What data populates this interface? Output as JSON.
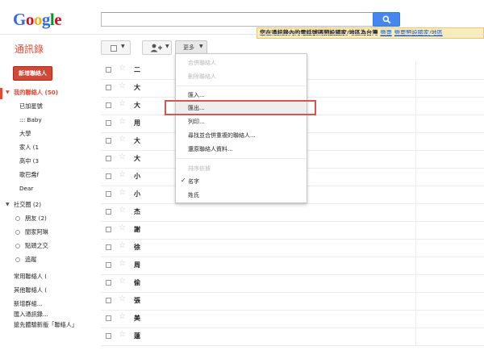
{
  "header": {
    "logo_letters": [
      {
        "ch": "G",
        "color": "#3369e8"
      },
      {
        "ch": "o",
        "color": "#d50f25"
      },
      {
        "ch": "o",
        "color": "#eeb211"
      },
      {
        "ch": "g",
        "color": "#3369e8"
      },
      {
        "ch": "l",
        "color": "#009925"
      },
      {
        "ch": "e",
        "color": "#d50f25"
      }
    ],
    "search_icon": "search-icon",
    "notice": {
      "message": "您在通訊錄內的電話號碼預設國家/地區為台灣",
      "link_change": "變更",
      "link_change_default": "變更預設國家/地區"
    }
  },
  "page_title": "通訊錄",
  "toolbar": {
    "more_label": "更多",
    "add_icon": "add-person-icon"
  },
  "sidebar": {
    "new_contact": "新增聯絡人",
    "my_contacts": "我的聯絡人 (50)",
    "groups": [
      "已加星號",
      "::: Baby",
      "大學",
      "家人 (1",
      "高中 (3",
      "歌巴喬f",
      "Dear"
    ],
    "circles_header": "社交圈 (2)",
    "circles": [
      "朋友 (2)",
      "閨家阿琳",
      "點頭之交",
      "追蹤"
    ],
    "frequent": "常用聯絡人 (",
    "other": "其他聯絡人 (",
    "new_group": "新增群組...",
    "import": "匯入通訊錄...",
    "try_new": "搶先體驗新版「聯絡人」"
  },
  "contacts": [
    "二",
    "大",
    "大",
    "用",
    "大",
    "大",
    "小",
    "小",
    "杰",
    "謝",
    "徐",
    "周",
    "偷",
    "張",
    "美",
    "蓮"
  ],
  "menu": {
    "items_disabled_top": [
      "合併聯絡人",
      "刪除聯絡人"
    ],
    "import": "匯入...",
    "export": "匯出...",
    "print": "列印...",
    "find_duplicates": "尋找並合併重複的聯絡人...",
    "restore": "還原聯絡人資料...",
    "sort_header": "排序依據",
    "sort_first": "名字",
    "sort_last": "姓氏",
    "check": "✓"
  },
  "colors": {
    "accent_red": "#dd4b39",
    "search_blue": "#4787ed",
    "notice_bg": "#f9edbe",
    "highlight_box": "#d9534f"
  }
}
